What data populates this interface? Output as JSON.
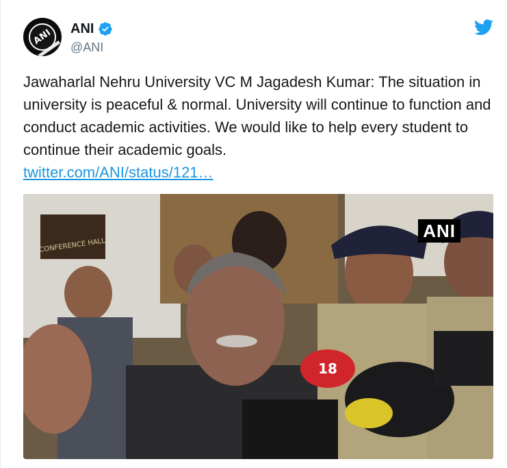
{
  "tweet": {
    "display_name": "ANI",
    "handle": "@ANI",
    "avatar_logo_text": "ANI",
    "text": "Jawaharlal Nehru University VC M Jagadesh Kumar: The situation in university is peaceful & normal. University will continue to function and conduct academic activities. We would like to help every student to continue their academic goals.",
    "link_text": "twitter.com/ANI/status/121…"
  },
  "media": {
    "watermark": "ANI",
    "sign_text": "CONFERENCE HALL",
    "mic_label": "18"
  },
  "icons": {
    "verified": "verified-badge-icon",
    "twitter": "twitter-bird-icon"
  },
  "colors": {
    "twitter_blue": "#1da1f2",
    "link_blue": "#1b95e0",
    "text": "#14171a",
    "secondary_text": "#657786"
  }
}
